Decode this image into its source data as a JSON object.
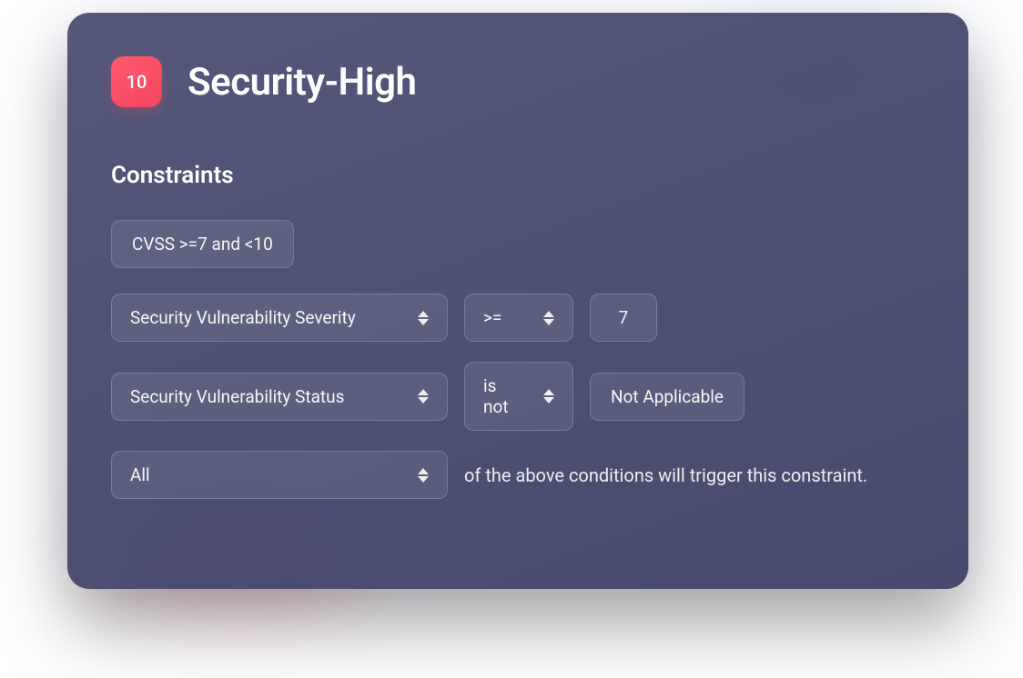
{
  "header": {
    "badge_number": "10",
    "title": "Security-High"
  },
  "section_label": "Constraints",
  "static_chip": "CVSS >=7 and <10",
  "rows": [
    {
      "field": "Security Vulnerability Severity",
      "operator": ">=",
      "value": "7"
    },
    {
      "field": "Security Vulnerability Status",
      "operator": "is not",
      "value": "Not Applicable"
    }
  ],
  "quantifier": {
    "value": "All",
    "trailing_text": "of the above conditions will trigger this constraint."
  },
  "colors": {
    "badge": "#f44560",
    "panel": "#44486c"
  }
}
